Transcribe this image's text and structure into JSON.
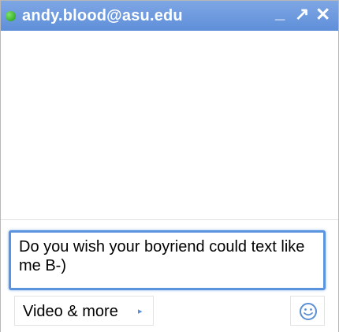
{
  "title_bar": {
    "contact": "andy.blood@asu.edu",
    "status_color": "#2db51f",
    "controls": {
      "minimize": "_",
      "popout": "↗",
      "close": "✕"
    }
  },
  "compose": {
    "message_value": "Do you wish your boyriend could text like me B-)",
    "video_label": "Video & more",
    "video_arrow": "▸",
    "emoticon_icon": "smiley-icon"
  },
  "colors": {
    "title_bar": "#6a97dd",
    "input_border": "#5a93de"
  }
}
